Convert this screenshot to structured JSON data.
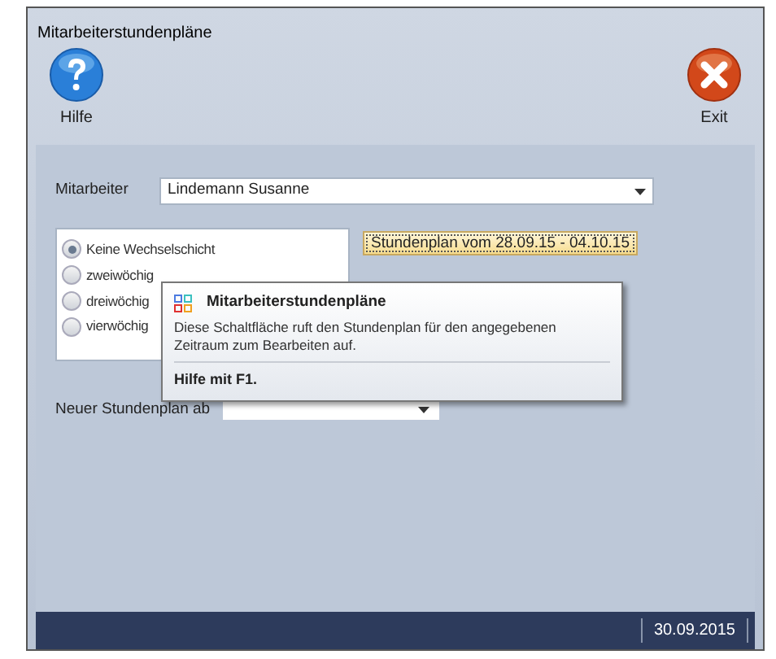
{
  "window": {
    "title": "Mitarbeiterstundenpläne"
  },
  "toolbar": [
    {
      "kind": "help",
      "label": "Hilfe"
    },
    {
      "kind": "exit",
      "label": "Exit"
    }
  ],
  "employee": {
    "label": "Mitarbeiter",
    "value": "Lindemann Susanne"
  },
  "rotation_options": [
    {
      "label": "Keine Wechselschicht",
      "selected": true
    },
    {
      "label": "zweiwöchig",
      "selected": false
    },
    {
      "label": "dreiwöchig",
      "selected": false
    },
    {
      "label": "vierwöchig",
      "selected": false
    }
  ],
  "schedule_button": "Stundenplan vom 28.09.15 - 04.10.15",
  "tooltip": {
    "title": "Mitarbeiterstundenpläne",
    "text": "Diese Schaltfläche ruft den Stundenplan für den angegebenen Zeitraum zum Bearbeiten auf.",
    "footer": "Hilfe mit F1."
  },
  "new_schedule": {
    "label": "Neuer Stundenplan ab"
  },
  "status_bar": {
    "date": "30.09.2015"
  }
}
